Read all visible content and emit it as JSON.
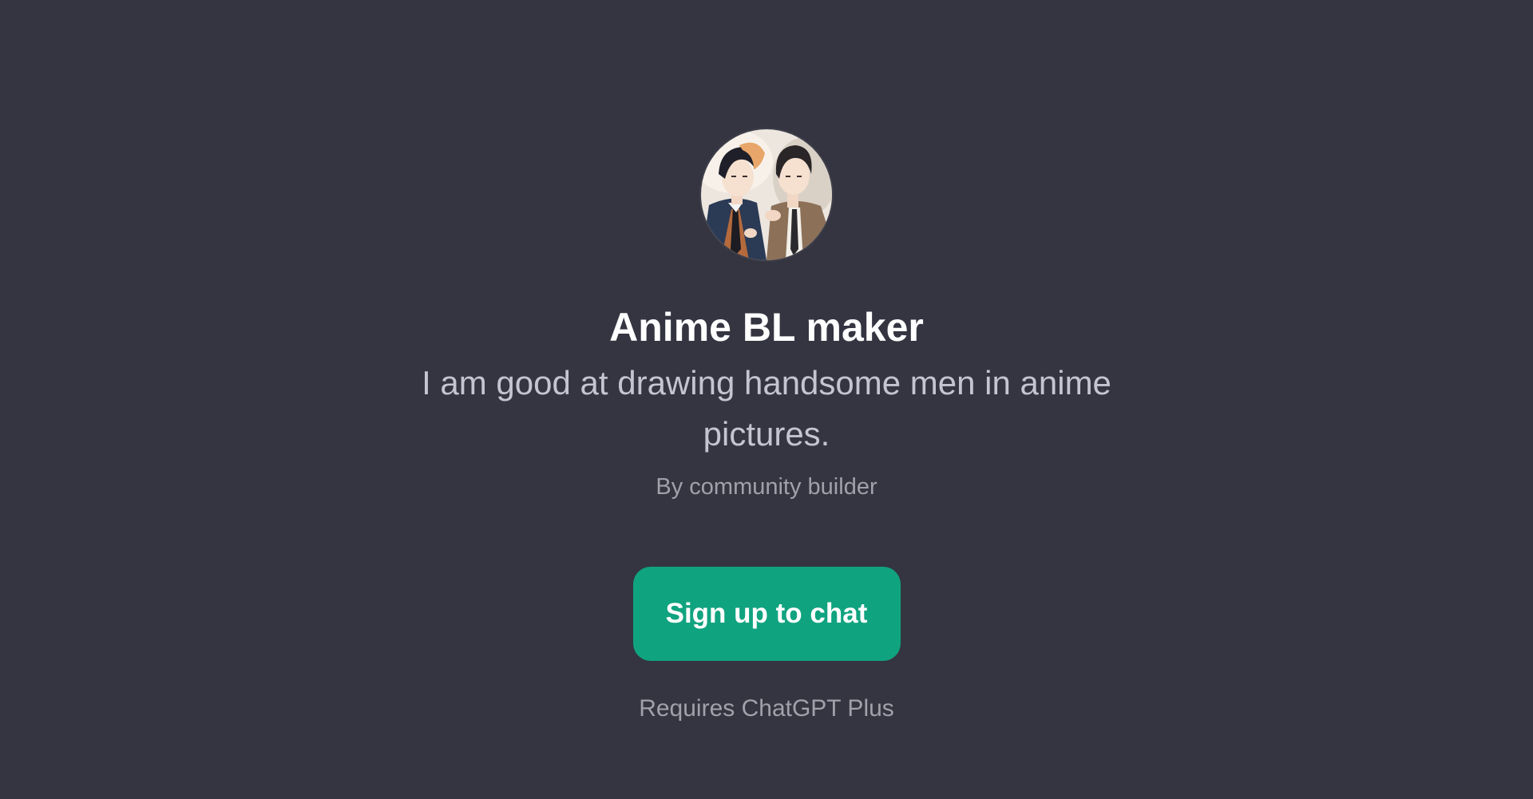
{
  "gpt": {
    "avatar_icon": "anime-men-portrait-icon",
    "name": "Anime BL maker",
    "description": "I am good at drawing handsome men in anime pictures.",
    "byline": "By community builder"
  },
  "cta": {
    "signup_label": "Sign up to chat",
    "requirement": "Requires ChatGPT Plus"
  },
  "colors": {
    "background": "#343541",
    "accent": "#10a37f",
    "title": "#ffffff",
    "muted": "#a1a1aa"
  }
}
